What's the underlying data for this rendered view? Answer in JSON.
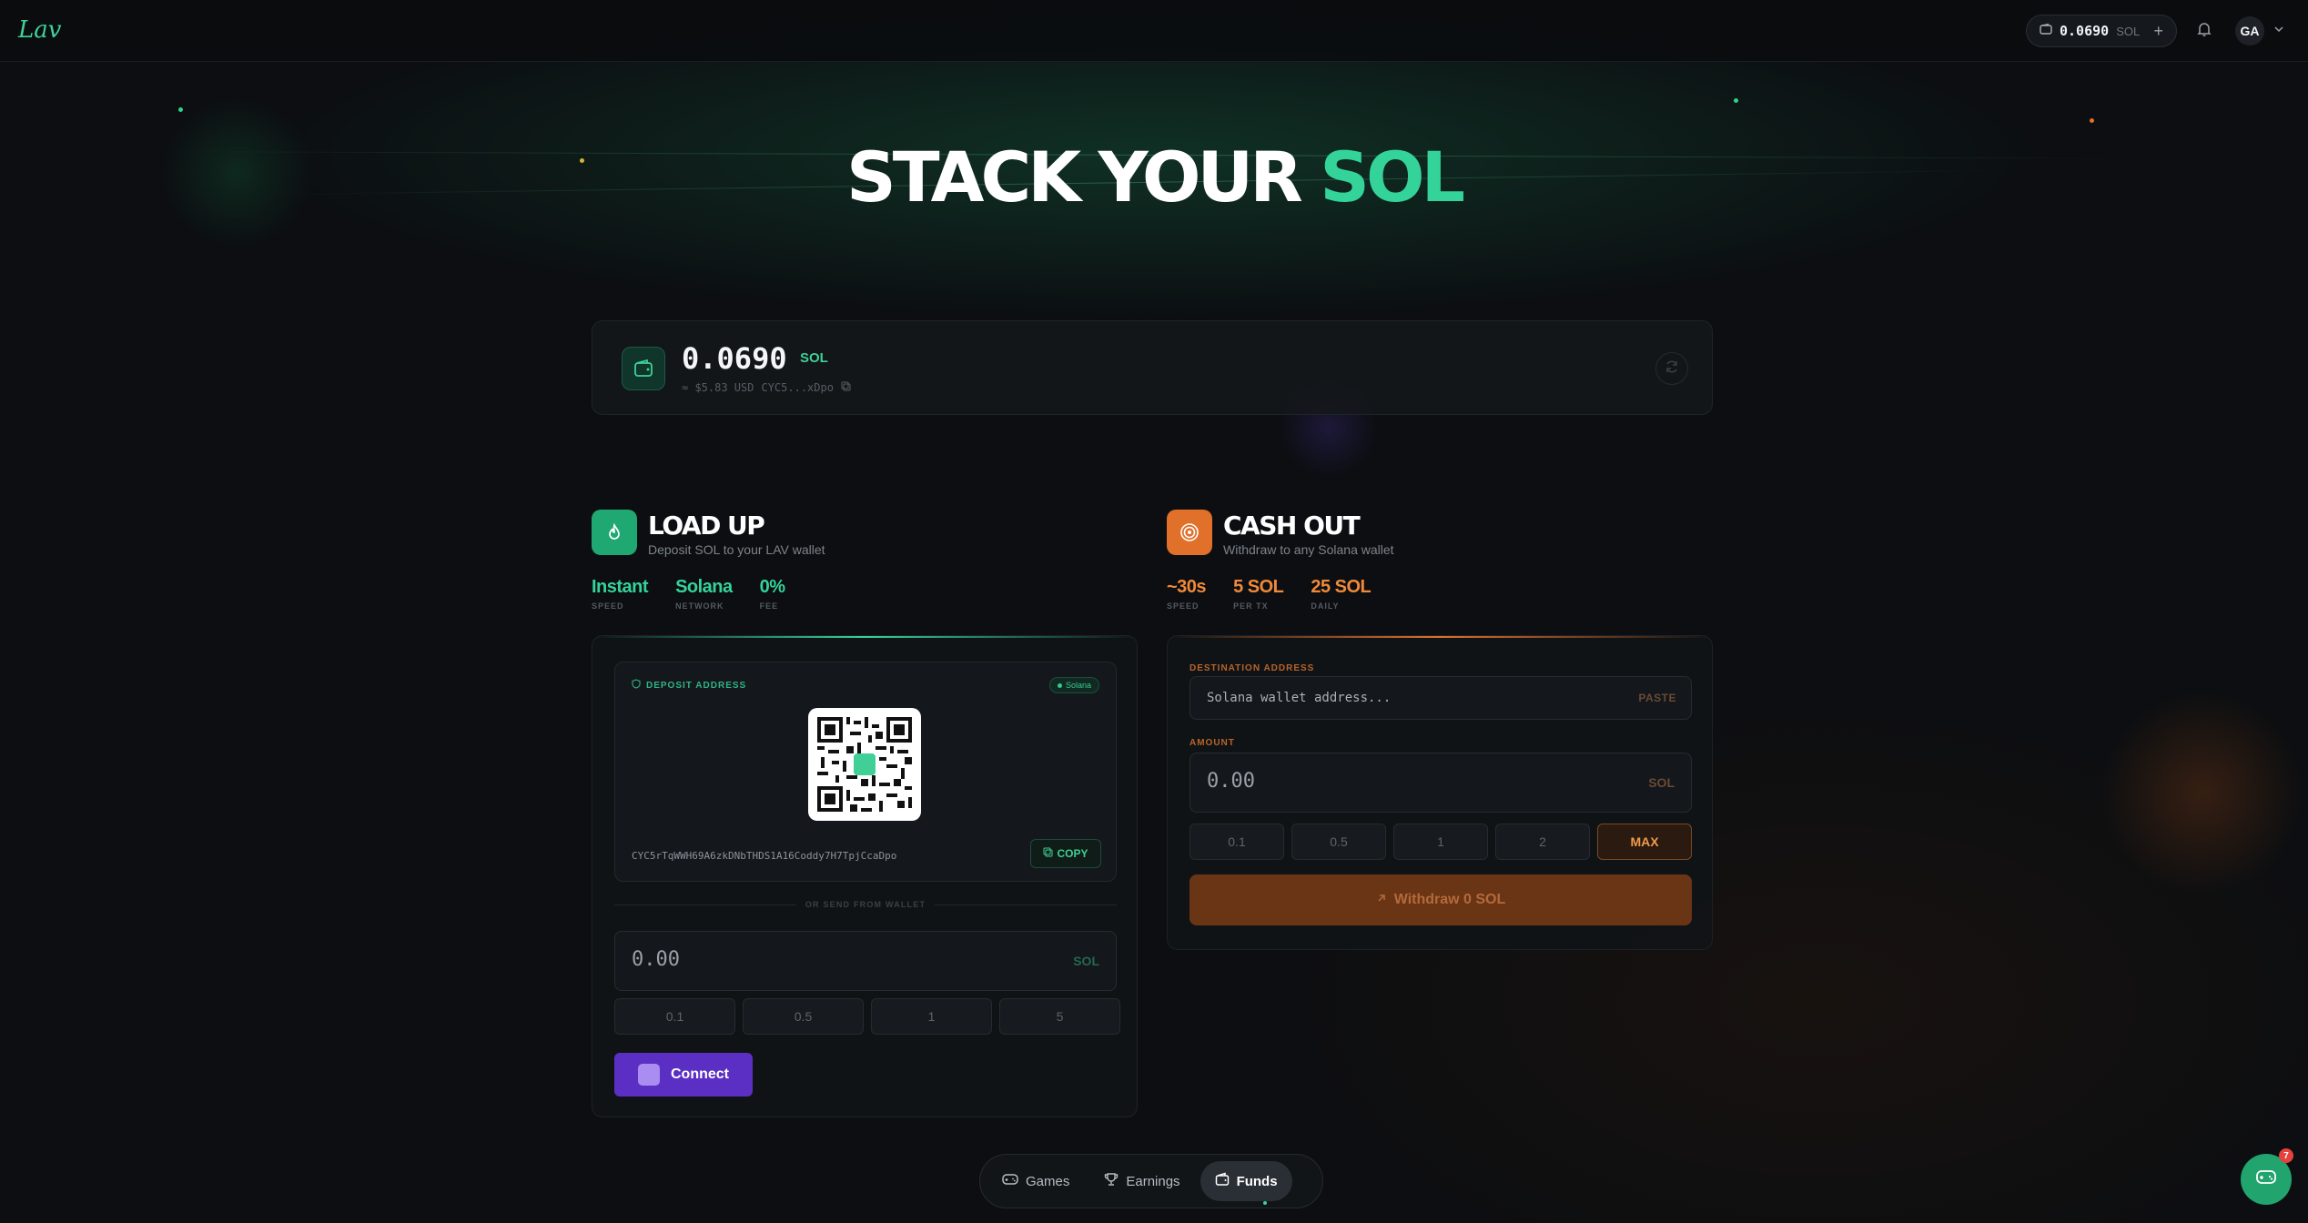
{
  "header": {
    "logo_text": "Lav",
    "balance": "0.0690",
    "balance_unit": "SOL",
    "add_symbol": "+",
    "avatar_initials": "GA"
  },
  "hero": {
    "word1": "STACK YOUR ",
    "word2": "SOL"
  },
  "wallet": {
    "amount": "0.0690",
    "unit": "SOL",
    "usd": "≈ $5.83 USD",
    "address_short": "CYC5...xDpo"
  },
  "load_up": {
    "title": "LOAD UP",
    "subtitle": "Deposit SOL to your LAV wallet",
    "stats": [
      {
        "value": "Instant",
        "label": "SPEED"
      },
      {
        "value": "Solana",
        "label": "NETWORK"
      },
      {
        "value": "0%",
        "label": "FEE"
      }
    ],
    "deposit_label": "DEPOSIT ADDRESS",
    "network_chip": "Solana",
    "deposit_address": "CYC5rTqWWH69A6zkDNbTHDS1A16Coddy7H7TpjCcaDpo",
    "copy_label": "COPY",
    "divider": "OR SEND FROM WALLET",
    "amount_placeholder": "0.00",
    "amount_unit": "SOL",
    "quick_amounts": [
      "0.1",
      "0.5",
      "1",
      "5"
    ],
    "connect_label": "Connect"
  },
  "cash_out": {
    "title": "CASH OUT",
    "subtitle": "Withdraw to any Solana wallet",
    "stats": [
      {
        "value": "~30s",
        "label": "SPEED"
      },
      {
        "value": "5 SOL",
        "label": "PER TX"
      },
      {
        "value": "25 SOL",
        "label": "DAILY"
      }
    ],
    "destination_label": "DESTINATION ADDRESS",
    "destination_placeholder": "Solana wallet address...",
    "paste_label": "PASTE",
    "amount_label": "AMOUNT",
    "amount_placeholder": "0.00",
    "amount_unit": "SOL",
    "quick_amounts": [
      "0.1",
      "0.5",
      "1",
      "2"
    ],
    "max_label": "MAX",
    "withdraw_label": "Withdraw 0 SOL"
  },
  "nav": {
    "items": [
      {
        "label": "Games"
      },
      {
        "label": "Earnings"
      },
      {
        "label": "Funds"
      }
    ]
  },
  "chat": {
    "badge_count": "7"
  },
  "colors": {
    "green_accent": "#34d39a",
    "orange_accent": "#f08a3a",
    "connect_purple": "#5b2fc4"
  }
}
